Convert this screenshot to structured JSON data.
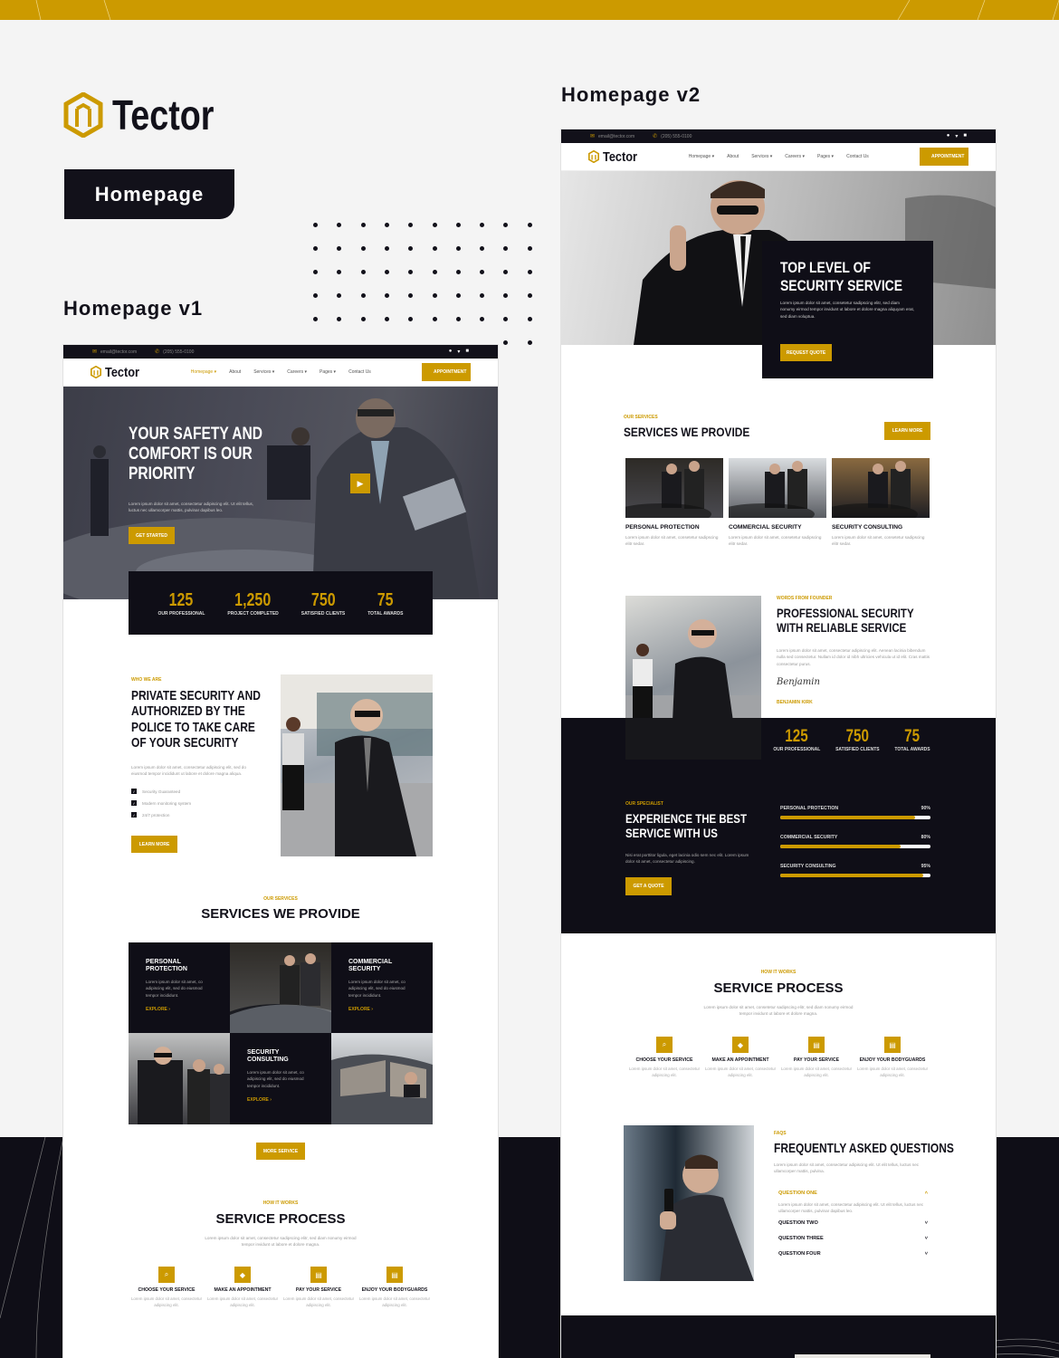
{
  "brand": {
    "name": "Tector",
    "accent": "#cc9a00",
    "dark": "#12111a"
  },
  "badge": "Homepage",
  "labels": {
    "v1": "Homepage v1",
    "v2": "Homepage v2"
  },
  "topbar": {
    "email": "email@tector.com",
    "phone": "(205) 555-0100",
    "social": [
      "facebook-icon",
      "twitter-icon",
      "youtube-icon"
    ]
  },
  "nav": {
    "items": [
      "Homepage",
      "About",
      "Services",
      "Careers",
      "Pages",
      "Contact Us"
    ],
    "dropdowns": [
      true,
      false,
      true,
      true,
      true,
      false
    ],
    "cta": "APPOINTMENT"
  },
  "v1": {
    "hero": {
      "title": "YOUR SAFETY AND COMFORT IS OUR PRIORITY",
      "text": "Lorem ipsum dolor sit amet, consectetur adipiscing elit. Ut elit tellus, luctus nec ullamcorper mattis, pulvinar dapibus leo.",
      "cta": "GET STARTED"
    },
    "stats": [
      {
        "value": "125",
        "label": "OUR PROFESSIONAL"
      },
      {
        "value": "1,250",
        "label": "PROJECT COMPLETED"
      },
      {
        "value": "750",
        "label": "SATISFIED CLIENTS"
      },
      {
        "value": "75",
        "label": "TOTAL AWARDS"
      }
    ],
    "about": {
      "kicker": "WHO WE ARE",
      "title": "PRIVATE SECURITY AND AUTHORIZED BY THE POLICE TO TAKE CARE OF YOUR SECURITY",
      "text": "Lorem ipsum dolor sit amet, consectetur adipiscing elit, sed do eiusmod tempor incididunt ut labore et dolore magna aliqua.",
      "checks": [
        "Security Guaranteed",
        "Modern monitoring system",
        "24/7 protection"
      ],
      "cta": "LEARN MORE"
    },
    "services": {
      "kicker": "OUR SERVICES",
      "title": "SERVICES WE PROVIDE",
      "items": [
        {
          "title": "PERSONAL PROTECTION",
          "text": "Lorem ipsum dolor sit amet, co adipiscing elit, sed do eiusmod tempor incididunt.",
          "link": "EXPLORE"
        },
        {
          "title": "COMMERCIAL SECURITY",
          "text": "Lorem ipsum dolor sit amet, co adipiscing elit, sed do eiusmod tempor incididunt.",
          "link": "EXPLORE"
        },
        {
          "title": "SECURITY CONSULTING",
          "text": "Lorem ipsum dolor sit amet, co adipiscing elit, sed do eiusmod tempor incididunt.",
          "link": "EXPLORE"
        }
      ],
      "cta": "MORE SERVICE"
    },
    "process": {
      "kicker": "HOW IT WORKS",
      "title": "SERVICE PROCESS",
      "text": "Lorem ipsum dolor sit amet, consectetur sadipscing elitr, sed diam nonumy eirmod tempor invidunt ut labore et dolore magna.",
      "steps": [
        {
          "icon": "search-icon",
          "title": "CHOOSE YOUR SERVICE",
          "text": "Lorem ipsum dolor sit amet, consectetur adipiscing elit."
        },
        {
          "icon": "handshake-icon",
          "title": "MAKE AN APPOINTMENT",
          "text": "Lorem ipsum dolor sit amet, consectetur adipiscing elit."
        },
        {
          "icon": "card-icon",
          "title": "PAY YOUR SERVICE",
          "text": "Lorem ipsum dolor sit amet, consectetur adipiscing elit."
        },
        {
          "icon": "card-icon",
          "title": "ENJOY YOUR BODYGUARDS",
          "text": "Lorem ipsum dolor sit amet, consectetur adipiscing elit."
        }
      ]
    }
  },
  "v2": {
    "hero": {
      "title": "TOP LEVEL OF SECURITY SERVICE",
      "text": "Lorem ipsum dolor sit amet, consetetur sadipscing elitr, sed diam nonumy eirmod tempor invidunt ut labore et dolore magna aliquyam erat, sed diam voluptua.",
      "cta": "REQUEST QUOTE"
    },
    "services": {
      "kicker": "OUR SERVICES",
      "title": "SERVICES WE PROVIDE",
      "cta": "LEARN MORE",
      "items": [
        {
          "title": "PERSONAL PROTECTION",
          "text": "Lorem ipsum dolor sit amet, consetetur sadipscing elitr sedar."
        },
        {
          "title": "COMMERCIAL SECURITY",
          "text": "Lorem ipsum dolor sit amet, consetetur sadipscing elitr sedar."
        },
        {
          "title": "SECURITY CONSULTING",
          "text": "Lorem ipsum dolor sit amet, consetetur sadipscing elitr sedar."
        }
      ]
    },
    "founder": {
      "kicker": "WORDS FROM FOUNDER",
      "title": "PROFESSIONAL SECURITY WITH RELIABLE SERVICE",
      "text": "Lorem ipsum dolor sit amet, consectetur adipiscing elit. Aenean lacinia bibendum nulla sed consectetur. Nullam id dolor id nibh ultricies vehicula ut id elit. Cras mattis consectetur purus.",
      "signature": "Benjamin",
      "name": "BENJAMIN KIRK"
    },
    "stats": [
      {
        "value": "125",
        "label": "OUR PROFESSIONAL"
      },
      {
        "value": "750",
        "label": "SATISFIED CLIENTS"
      },
      {
        "value": "75",
        "label": "TOTAL AWARDS"
      }
    ],
    "specialist": {
      "kicker": "OUR SPECIALIST",
      "title": "EXPERIENCE THE BEST SERVICE WITH US",
      "text": "Nisi erat porttitor ligula, eget lacinia odio sem nec elit. Lorem ipsum dolor sit amet, consectetur adipiscing.",
      "cta": "GET A QUOTE",
      "skills": [
        {
          "label": "PERSONAL PROTECTION",
          "value": 90,
          "display": "90%"
        },
        {
          "label": "COMMERCIAL SECURITY",
          "value": 80,
          "display": "80%"
        },
        {
          "label": "SECURITY CONSULTING",
          "value": 95,
          "display": "95%"
        }
      ]
    },
    "process": {
      "kicker": "HOW IT WORKS",
      "title": "SERVICE PROCESS",
      "text": "Lorem ipsum dolor sit amet, consetetur sadipscing elitr, sed diam nonumy eirmod tempor invidunt ut labore et dolore magna.",
      "steps": [
        {
          "icon": "search-icon",
          "title": "CHOOSE YOUR SERVICE",
          "text": "Lorem ipsum dolor sit amet, consectetur adipiscing elit."
        },
        {
          "icon": "handshake-icon",
          "title": "MAKE AN APPOINTMENT",
          "text": "Lorem ipsum dolor sit amet, consectetur adipiscing elit."
        },
        {
          "icon": "card-icon",
          "title": "PAY YOUR SERVICE",
          "text": "Lorem ipsum dolor sit amet, consectetur adipiscing elit."
        },
        {
          "icon": "card-icon",
          "title": "ENJOY YOUR BODYGUARDS",
          "text": "Lorem ipsum dolor sit amet, consectetur adipiscing elit."
        }
      ]
    },
    "faq": {
      "kicker": "FAQS",
      "title": "FREQUENTLY ASKED QUESTIONS",
      "text": "Lorem ipsum dolor sit amet, consectetur adipiscing elit. Ut elit tellus, luctus nec ullamcorper mattis, pulvina.",
      "items": [
        {
          "q": "QUESTION ONE",
          "open": true,
          "a": "Lorem ipsum dolor sit amet, consectetur adipiscing elit. Ut elit tellus, luctus nec ullamcorper mattis, pulvinar dapibus leo."
        },
        {
          "q": "QUESTION TWO",
          "open": false
        },
        {
          "q": "QUESTION THREE",
          "open": false
        },
        {
          "q": "QUESTION FOUR",
          "open": false
        }
      ]
    }
  }
}
